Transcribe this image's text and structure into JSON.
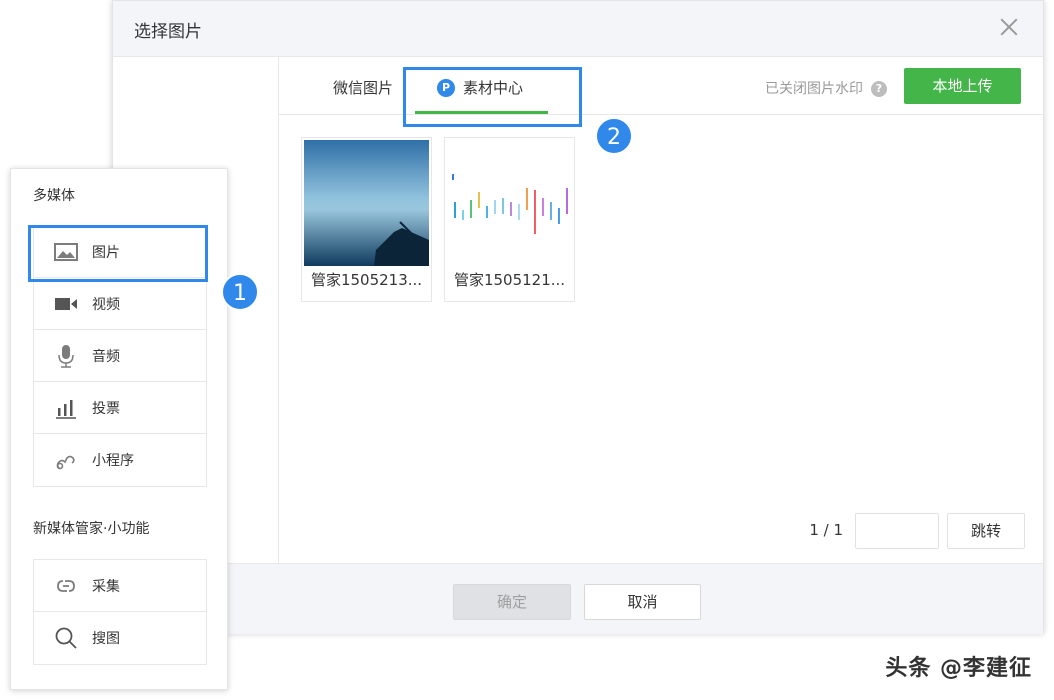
{
  "dialog": {
    "title": "选择图片",
    "close_icon": "close-icon",
    "tabs": [
      {
        "label": "微信图片",
        "active": false
      },
      {
        "label": "素材中心",
        "badge": "P",
        "active": true
      }
    ],
    "watermark_status": "已关闭图片水印",
    "help_icon": "?",
    "upload_label": "本地上传",
    "images": [
      {
        "caption": "管家1505213..."
      },
      {
        "caption": "管家1505121..."
      }
    ],
    "pager": {
      "text": "1 / 1",
      "input_value": "",
      "jump_label": "跳转"
    },
    "footer": {
      "ok_label": "确定",
      "cancel_label": "取消"
    }
  },
  "sidebar": {
    "section1_title": "多媒体",
    "items": [
      {
        "label": "图片",
        "icon": "image-icon"
      },
      {
        "label": "视频",
        "icon": "video-icon"
      },
      {
        "label": "音频",
        "icon": "microphone-icon"
      },
      {
        "label": "投票",
        "icon": "bar-chart-icon"
      },
      {
        "label": "小程序",
        "icon": "mini-program-icon"
      }
    ],
    "section2_title": "新媒体管家·小功能",
    "tools": [
      {
        "label": "采集",
        "icon": "collect-icon"
      },
      {
        "label": "搜图",
        "icon": "search-icon"
      }
    ]
  },
  "annotations": {
    "step1": "1",
    "step2": "2"
  },
  "brand_watermark": "头条 @李建征",
  "colors": {
    "accent_blue": "#2f88ea",
    "green": "#44b549"
  }
}
